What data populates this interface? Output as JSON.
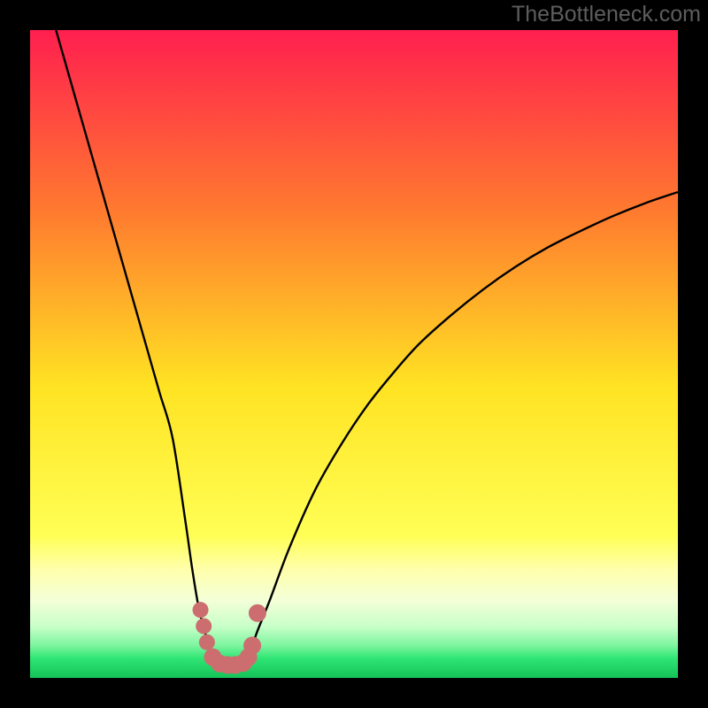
{
  "watermark": "TheBottleneck.com",
  "colors": {
    "frame": "#000000",
    "curve": "#000000",
    "markers": "#cc6e6f",
    "gradient_top": "#ff1f4f",
    "gradient_mid_upper": "#ff9a2a",
    "gradient_mid": "#ffe323",
    "gradient_lower": "#ffff7a",
    "gradient_pale": "#f7ffcf",
    "gradient_green": "#2fe574",
    "gradient_green2": "#18c85e"
  },
  "chart_data": {
    "type": "line",
    "title": "",
    "xlabel": "",
    "ylabel": "",
    "xlim": [
      0,
      100
    ],
    "ylim": [
      0,
      100
    ],
    "series": [
      {
        "name": "bottleneck-curve",
        "x": [
          4,
          6,
          8,
          10,
          12,
          14,
          16,
          18,
          20,
          22,
          24,
          25,
          26,
          27,
          28,
          29,
          30,
          31,
          32,
          33,
          34,
          35,
          37,
          40,
          44,
          48,
          52,
          56,
          60,
          65,
          70,
          75,
          80,
          85,
          90,
          95,
          100
        ],
        "y": [
          100,
          93,
          86,
          79,
          72,
          65,
          58,
          51,
          44,
          37,
          24,
          17,
          11,
          7,
          4,
          2.5,
          2,
          2,
          2,
          2.5,
          4,
          7,
          12,
          20,
          29,
          36,
          42,
          47,
          51.5,
          56,
          60,
          63.5,
          66.5,
          69,
          71.3,
          73.3,
          75
        ]
      }
    ],
    "markers": {
      "name": "highlight-points",
      "x": [
        26.3,
        26.8,
        27.3,
        28.2,
        29.3,
        30.5,
        31.7,
        32.9,
        33.7,
        34.3,
        35.1
      ],
      "y": [
        10.5,
        8.0,
        5.5,
        3.2,
        2.2,
        2.0,
        2.0,
        2.3,
        3.2,
        5.0,
        10.0
      ],
      "r": [
        9,
        9,
        9,
        10,
        10,
        10,
        10,
        10,
        10,
        10,
        10
      ]
    },
    "background_gradient_stops": [
      {
        "pct": 0,
        "color": "#ff1f4f"
      },
      {
        "pct": 28,
        "color": "#ff7a2f"
      },
      {
        "pct": 55,
        "color": "#ffe323"
      },
      {
        "pct": 78,
        "color": "#ffff55"
      },
      {
        "pct": 83,
        "color": "#ffffa8"
      },
      {
        "pct": 88,
        "color": "#f4ffd8"
      },
      {
        "pct": 92,
        "color": "#c9ffc9"
      },
      {
        "pct": 95,
        "color": "#7df59e"
      },
      {
        "pct": 97,
        "color": "#2fe574"
      },
      {
        "pct": 100,
        "color": "#14c258"
      }
    ]
  }
}
